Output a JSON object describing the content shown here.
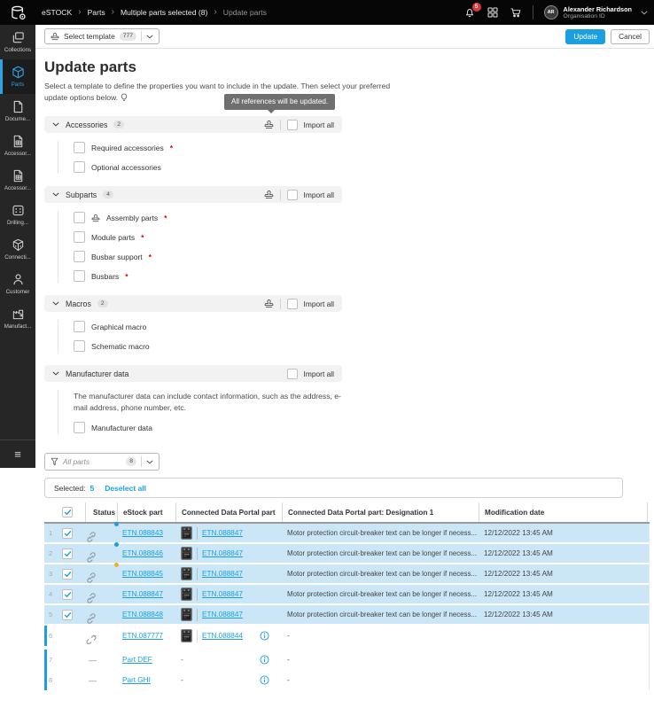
{
  "colors": {
    "accent": "#1b9fe0",
    "selected_row": "#cbe7f7",
    "warning_dot": "#f0b31c",
    "notification_red": "#e1353f"
  },
  "header": {
    "breadcrumb": [
      "eSTOCK",
      "Parts",
      "Multiple parts selected (8)",
      "Update parts"
    ],
    "notification_count": "5",
    "user": {
      "initials": "AR",
      "name": "Alexander Richardson",
      "org": "Organisation ID"
    }
  },
  "sidebar": {
    "items": [
      {
        "label": "Collections",
        "icon": "collections-icon",
        "active": false
      },
      {
        "label": "Parts",
        "icon": "parts-icon",
        "active": true
      },
      {
        "label": "Docume...",
        "icon": "document-icon",
        "active": false
      },
      {
        "label": "Accessor...",
        "icon": "accessory-icon",
        "active": false
      },
      {
        "label": "Accessor...",
        "icon": "accessory-icon",
        "active": false
      },
      {
        "label": "Drilling...",
        "icon": "drilling-icon",
        "active": false
      },
      {
        "label": "Connecti...",
        "icon": "connections-icon",
        "active": false
      },
      {
        "label": "Customer",
        "icon": "customer-icon",
        "active": false
      },
      {
        "label": "Manufact...",
        "icon": "manufacturer-icon",
        "active": false
      }
    ]
  },
  "toolbar": {
    "select_template_label": "Select template",
    "template_count": "777",
    "update_label": "Update",
    "cancel_label": "Cancel"
  },
  "page": {
    "title": "Update parts",
    "description": "Select a template to define the properties you want to include in the update. Then select your preferred update options below.",
    "tooltip": "All references will be updated."
  },
  "sections": [
    {
      "title": "Accessories",
      "badge": "2",
      "stamp": true,
      "import_all": "Import all",
      "description": "",
      "items": [
        {
          "label": "Required accessories",
          "required": true,
          "stamp": false
        },
        {
          "label": "Optional accessories",
          "required": false,
          "stamp": false
        }
      ]
    },
    {
      "title": "Subparts",
      "badge": "4",
      "stamp": true,
      "import_all": "Import all",
      "description": "",
      "items": [
        {
          "label": "Assembly parts",
          "required": true,
          "stamp": true
        },
        {
          "label": "Module parts",
          "required": true,
          "stamp": false
        },
        {
          "label": "Busbar support",
          "required": true,
          "stamp": false
        },
        {
          "label": "Busbars",
          "required": true,
          "stamp": false
        }
      ]
    },
    {
      "title": "Macros",
      "badge": "2",
      "stamp": true,
      "import_all": "Import all",
      "description": "",
      "items": [
        {
          "label": "Graphical macro",
          "required": false,
          "stamp": false
        },
        {
          "label": "Schematic macro",
          "required": false,
          "stamp": false
        }
      ]
    },
    {
      "title": "Manufacturer data",
      "badge": "",
      "stamp": false,
      "import_all": "Import all",
      "description": "The manufacturer data can include contact information, such as the address, e-mail address, phone number, etc.",
      "items": [
        {
          "label": "Manufacturer data",
          "required": false,
          "stamp": false
        }
      ]
    }
  ],
  "filter": {
    "value": "All parts",
    "count": "8"
  },
  "table": {
    "selected_label": "Selected:",
    "selected_count": "5",
    "deselect_label": "Deselect all",
    "columns": [
      "Status",
      "eStock part",
      "Connected Data Portal part",
      "Connected Data Portal part: Designation 1",
      "Modification date"
    ],
    "rows": [
      {
        "num": "1",
        "checked": true,
        "selected": true,
        "link": true,
        "broken": false,
        "dash": false,
        "dot": "#1b9fe0",
        "estock": "ETN.088843",
        "image": true,
        "cdp_link": "ETN.088847",
        "cdp_text": "",
        "info": false,
        "designation": "Motor protection circuit-breaker text can be longer if necess...",
        "date": "12/12/2022 13:45 AM",
        "leftbar": false,
        "gap": false
      },
      {
        "num": "2",
        "checked": true,
        "selected": true,
        "link": true,
        "broken": false,
        "dash": false,
        "dot": "#1b9fe0",
        "estock": "ETN.088846",
        "image": true,
        "cdp_link": "ETN.088847",
        "cdp_text": "",
        "info": false,
        "designation": "Motor protection circuit-breaker text can be longer if necess...",
        "date": "12/12/2022 13:45 AM",
        "leftbar": false,
        "gap": false
      },
      {
        "num": "3",
        "checked": true,
        "selected": true,
        "link": true,
        "broken": false,
        "dash": false,
        "dot": "#f0b31c",
        "estock": "ETN.088845",
        "image": true,
        "cdp_link": "ETN.088847",
        "cdp_text": "",
        "info": false,
        "designation": "Motor protection circuit-breaker text can be longer if necess...",
        "date": "12/12/2022 13:45 AM",
        "leftbar": false,
        "gap": false
      },
      {
        "num": "4",
        "checked": true,
        "selected": true,
        "link": true,
        "broken": false,
        "dash": false,
        "dot": "",
        "estock": "ETN.088847",
        "image": true,
        "cdp_link": "ETN.088847",
        "cdp_text": "",
        "info": false,
        "designation": "Motor protection circuit-breaker text can be longer if necess...",
        "date": "12/12/2022 13:45 AM",
        "leftbar": false,
        "gap": false
      },
      {
        "num": "5",
        "checked": true,
        "selected": true,
        "link": true,
        "broken": false,
        "dash": false,
        "dot": "",
        "estock": "ETN.088848",
        "image": true,
        "cdp_link": "ETN.088847",
        "cdp_text": "",
        "info": false,
        "designation": "Motor protection circuit-breaker text can be longer if necess...",
        "date": "12/12/2022 13:45 AM",
        "leftbar": false,
        "gap": false
      },
      {
        "num": "6",
        "checked": false,
        "selected": false,
        "link": false,
        "broken": true,
        "dash": false,
        "dot": "",
        "estock": "ETN.087777",
        "image": true,
        "cdp_link": "ETN.088844",
        "cdp_text": "",
        "info": true,
        "designation": "-",
        "date": "",
        "leftbar": true,
        "gap": true
      },
      {
        "num": "7",
        "checked": false,
        "selected": false,
        "link": false,
        "broken": false,
        "dash": true,
        "dot": "",
        "estock": "Part DEF",
        "image": false,
        "cdp_link": "",
        "cdp_text": "-",
        "info": true,
        "designation": "-",
        "date": "",
        "leftbar": true,
        "gap": false
      },
      {
        "num": "8",
        "checked": false,
        "selected": false,
        "link": false,
        "broken": false,
        "dash": true,
        "dot": "",
        "estock": "Part GHI",
        "image": false,
        "cdp_link": "",
        "cdp_text": "-",
        "info": true,
        "designation": "-",
        "date": "",
        "leftbar": true,
        "gap": false
      }
    ]
  }
}
